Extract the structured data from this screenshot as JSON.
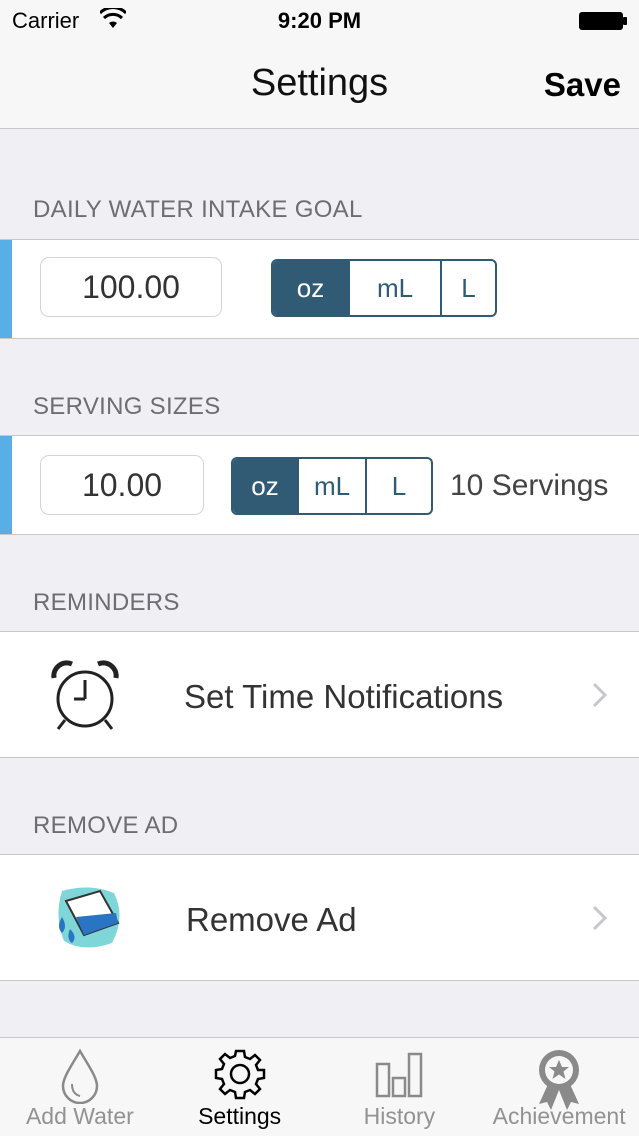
{
  "status_bar": {
    "carrier": "Carrier",
    "time": "9:20 PM"
  },
  "nav": {
    "title": "Settings",
    "save_label": "Save"
  },
  "daily_goal": {
    "header": "DAILY WATER INTAKE GOAL",
    "value": "100.00",
    "units": [
      "oz",
      "mL",
      "L"
    ],
    "selected_unit": "oz"
  },
  "serving": {
    "header": "SERVING SIZES",
    "value": "10.00",
    "units": [
      "oz",
      "mL",
      "L"
    ],
    "selected_unit": "oz",
    "count_text": "10 Servings"
  },
  "reminders": {
    "header": "REMINDERS",
    "label": "Set Time Notifications",
    "icon": "alarm-clock-icon"
  },
  "remove_ad": {
    "header": "REMOVE AD",
    "label": "Remove Ad",
    "icon": "water-glass-icon"
  },
  "tabs": [
    {
      "label": "Add Water",
      "icon": "water-drop-icon",
      "active": false
    },
    {
      "label": "Settings",
      "icon": "gear-icon",
      "active": true
    },
    {
      "label": "History",
      "icon": "bar-chart-icon",
      "active": false
    },
    {
      "label": "Achievement",
      "icon": "award-ribbon-icon",
      "active": false
    }
  ],
  "colors": {
    "accent": "#5aaee6",
    "segment": "#315b74",
    "background": "#efeff4"
  }
}
